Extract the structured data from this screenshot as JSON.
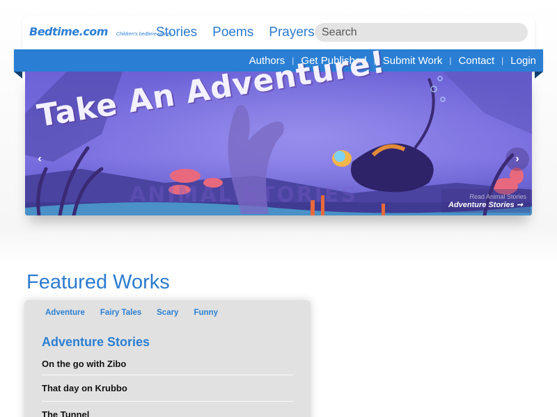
{
  "header": {
    "logo_text": "Bedtime.com",
    "tagline": "Children's bedtime stories",
    "nav": [
      "Stories",
      "Poems",
      "Prayers"
    ],
    "search_placeholder": "Search"
  },
  "subnav": [
    "Authors",
    "Get Published",
    "Submit Work",
    "Contact",
    "Login"
  ],
  "banner": {
    "headline": "Take An Adventure!",
    "ghost_text": "ANIMAL STORIES",
    "caption_sub": "Read Animal Stories",
    "caption_main": "Adventure Stories ➞",
    "prev_icon": "‹",
    "next_icon": "›"
  },
  "featured": {
    "title": "Featured Works",
    "tabs": [
      "Adventure",
      "Fairy Tales",
      "Scary",
      "Funny"
    ],
    "section_title": "Adventure Stories",
    "stories": [
      "On the go with Zibo",
      "That day on Krubbo",
      "The Tunnel"
    ]
  },
  "colors": {
    "brand_blue": "#2a7fd4",
    "card_gray": "#e1e1e1"
  }
}
